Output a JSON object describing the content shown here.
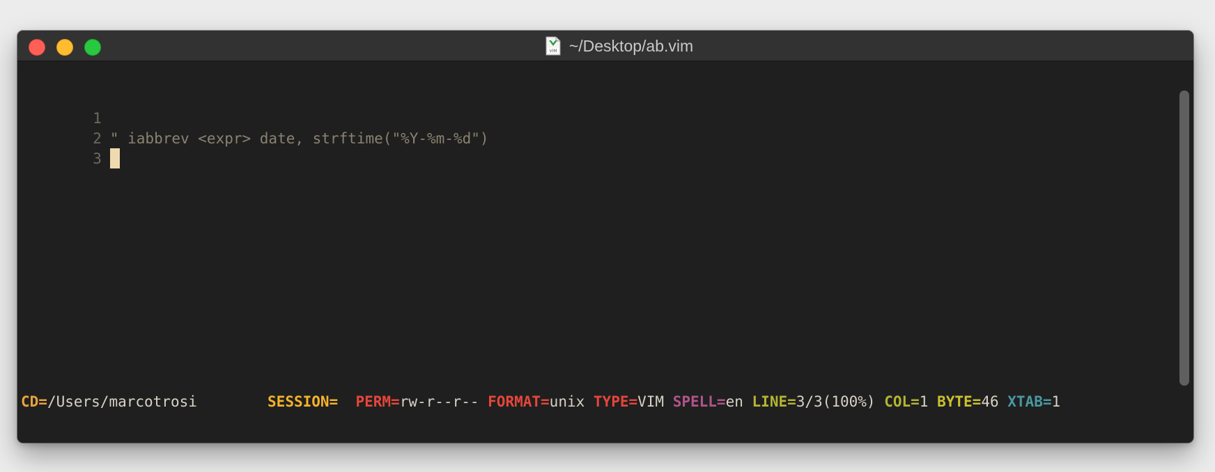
{
  "window": {
    "title": "~/Desktop/ab.vim",
    "icon": "vim-file-icon"
  },
  "editor": {
    "lines": [
      {
        "number": "1",
        "text": ""
      },
      {
        "number": "2",
        "text": "\" iabbrev <expr> date, strftime(\"%Y-%m-%d\")"
      },
      {
        "number": "3",
        "text": ""
      }
    ],
    "cursor_line": 3
  },
  "statusline": {
    "cd_key": "CD=",
    "cd_value": "/Users/marcotrosi",
    "session_key": "SESSION=",
    "session_value": "",
    "perm_key": "PERM=",
    "perm_value": "rw-r--r--",
    "format_key": "FORMAT=",
    "format_value": "unix",
    "type_key": "TYPE=",
    "type_value": "VIM",
    "spell_key": "SPELL=",
    "spell_value": "en",
    "line_key": "LINE=",
    "line_value": "3/3(100%)",
    "col_key": "COL=",
    "col_value": "1",
    "byte_key": "BYTE=",
    "byte_value": "46",
    "xtab_key": "XTAB=",
    "xtab_value": "1"
  },
  "colors": {
    "background": "#1f1f1f",
    "cd": "#e8a33d",
    "session": "#f4b32a",
    "perm": "#e5463a",
    "format": "#e5463a",
    "type": "#e5463a",
    "spell": "#b0558a",
    "line": "#b3b533",
    "col": "#b3b533",
    "byte": "#c9c230",
    "xtab": "#4a98a2"
  }
}
